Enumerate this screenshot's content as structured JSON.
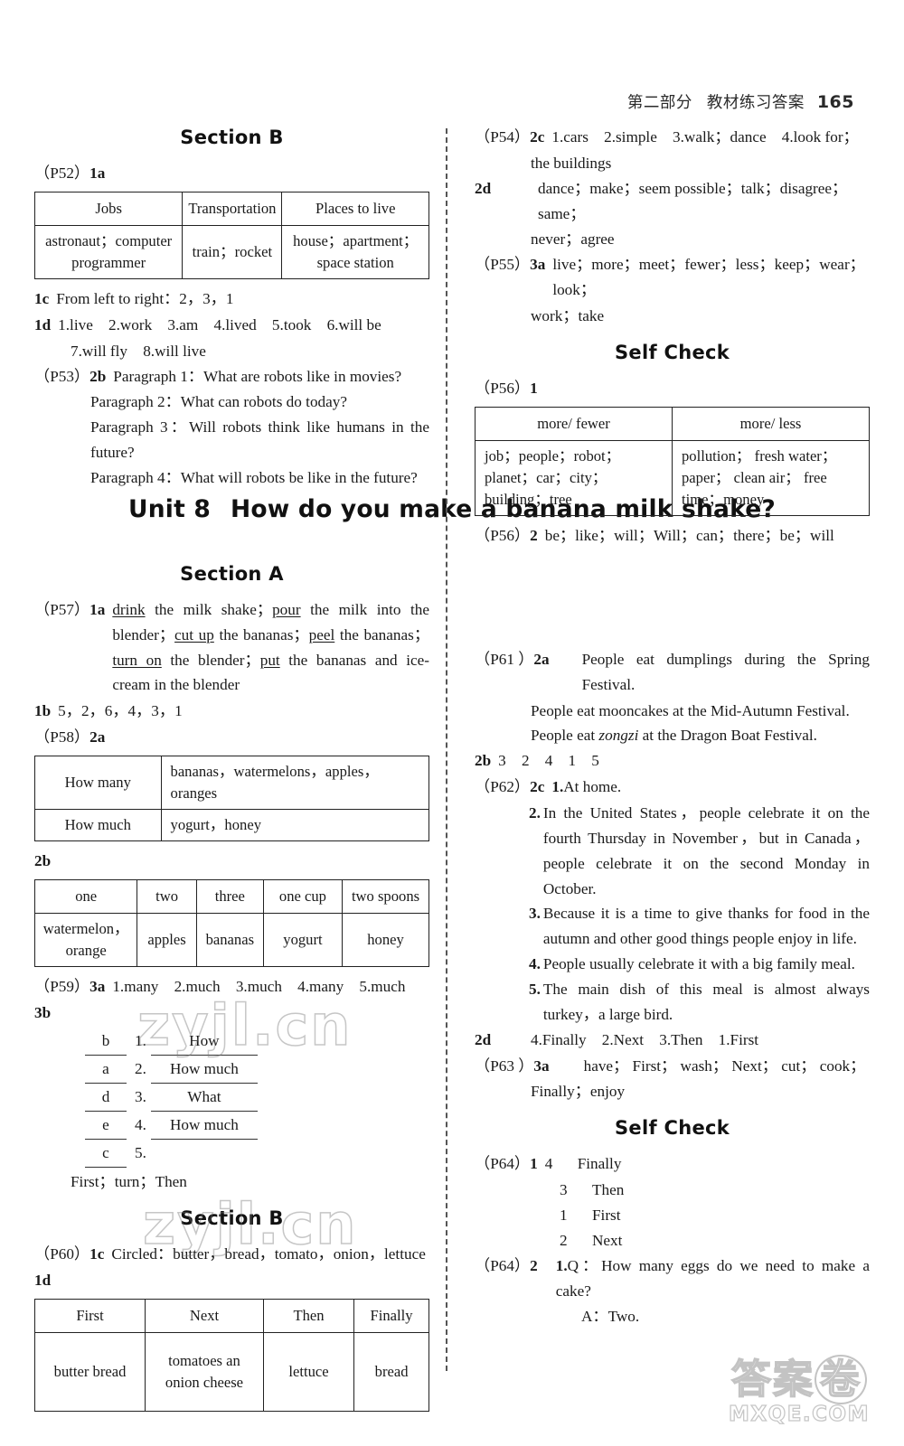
{
  "header": {
    "part_label": "第二部分",
    "section_label": "教材练习答案",
    "page_number": "165"
  },
  "left_column": {
    "section_b_heading": "Section B",
    "p52_tag_paren": "（P52）",
    "p52_tag_item": "1a",
    "table_1a": {
      "headers": [
        "Jobs",
        "Transportation",
        "Places to live"
      ],
      "row": [
        "astronaut；computer programmer",
        "train；rocket",
        "house；apartment；space station"
      ]
    },
    "entry_1c": {
      "tag": "1c",
      "text": "From left to right：2，3，1"
    },
    "entry_1d": {
      "tag": "1d",
      "line1": "1.live　2.work　3.am　4.lived　5.took　6.will be",
      "line2": "7.will fly　8.will live"
    },
    "entry_2b": {
      "tag_paren": "（P53）",
      "tag_item": "2b",
      "lines": [
        "Paragraph 1：What are robots like in movies?",
        "Paragraph 2：What can robots do today?",
        "Paragraph 3：Will robots think like humans in the future?",
        "Paragraph 4：What will robots be like in the future?"
      ]
    },
    "section_a_heading": "Section A",
    "entry_1a": {
      "tag_paren": "（P57）",
      "tag_item": "1a",
      "text_html": "<span class=\"u\">drink</span> the milk shake；<span class=\"u\">pour</span> the milk into the blender；<span class=\"u\">cut up</span> the bananas；<span class=\"u\">peel</span> the bananas；<span class=\"u\">turn on</span> the blender；<span class=\"u\">put</span> the bananas and ice-cream in the blender"
    },
    "entry_1b": {
      "tag": "1b",
      "text": "5，2，6，4，3，1"
    },
    "p58_tag_paren": "（P58）",
    "p58_tag_item": "2a",
    "table_2a": {
      "rows": [
        {
          "label": "How many",
          "value": "bananas，watermelons，apples，oranges"
        },
        {
          "label": "How much",
          "value": "yogurt，honey"
        }
      ]
    },
    "entry_2b_label": "2b",
    "table_2b": {
      "headers": [
        "one",
        "two",
        "three",
        "one cup",
        "two spoons"
      ],
      "row": [
        "watermelon，orange",
        "apples",
        "bananas",
        "yogurt",
        "honey"
      ]
    },
    "entry_3a": {
      "tag_paren": "（P59）",
      "tag_item": "3a",
      "text": "1.many　2.much　3.much　4.many　5.much"
    },
    "entry_3b": {
      "tag": "3b",
      "rows": [
        {
          "letter": "b",
          "n": "1.",
          "answer": "How"
        },
        {
          "letter": "a",
          "n": "2.",
          "answer": "How much"
        },
        {
          "letter": "d",
          "n": "3.",
          "answer": "What"
        },
        {
          "letter": "e",
          "n": "4.",
          "answer": "How much"
        },
        {
          "letter": "c",
          "n": "5.",
          "answer": ""
        }
      ],
      "footer": "First；turn；Then"
    },
    "section_b_heading_2": "Section B",
    "entry_1c_b": {
      "tag_paren": "（P60）",
      "tag_item": "1c",
      "text": "Circled：butter，bread，tomato，onion，lettuce"
    },
    "entry_1d_label": "1d",
    "table_1d": {
      "headers": [
        "First",
        "Next",
        "Then",
        "Finally"
      ],
      "row": [
        "butter bread",
        "tomatoes an onion cheese",
        "lettuce",
        "bread"
      ]
    }
  },
  "right_column": {
    "entry_2c": {
      "tag_paren": "（P54）",
      "tag_item": "2c",
      "line1": "1.cars　2.simple　3.walk；dance　4.look for；",
      "line2": "the buildings"
    },
    "entry_2d": {
      "tag": "2d",
      "line1": "dance；make；seem possible；talk；disagree；same；",
      "line2": "never；agree"
    },
    "entry_3a_p55": {
      "tag_paren": "（P55）",
      "tag_item": "3a",
      "line1": "live；more；meet；fewer；less；keep；wear；look；",
      "line2": "work；take"
    },
    "self_check_heading": "Self Check",
    "p56_tag_paren": "（P56）",
    "p56_tag_item": "1",
    "table_sc1": {
      "headers": [
        "more/ fewer",
        "more/ less"
      ],
      "row": [
        "job；people；robot；planet；car；city；building；tree",
        "pollution； fresh water； paper； clean air； free time；money"
      ]
    },
    "entry_p56_2": {
      "tag_paren": "（P56）",
      "tag_item": "2",
      "text": "be；like；will；Will；can；there；be；will"
    },
    "entry_2a_p61": {
      "tag_paren": "（P61 ）",
      "tag_item": "2a",
      "line1": "People eat dumplings during the Spring Festival.",
      "line2": "People eat mooncakes at the Mid-Autumn Festival.",
      "line3_pre": "People eat ",
      "line3_ital": "zongzi",
      "line3_post": " at the Dragon Boat Festival."
    },
    "entry_2b_p61": {
      "tag": "2b",
      "text": "3　2　4　1　5"
    },
    "entry_2c_p62": {
      "tag_paren": "（P62）",
      "tag_item": "2c",
      "first_n": "1.",
      "first_text": "At home.",
      "items": [
        {
          "n": "2.",
          "text": "In the United States，people celebrate it on the fourth Thursday in November，but in Canada，people celebrate it on the second Monday in October."
        },
        {
          "n": "3.",
          "text": "Because it is a time to give thanks for food in the autumn and other good things people enjoy in life."
        },
        {
          "n": "4.",
          "text": "People usually celebrate it with a big family meal."
        },
        {
          "n": "5.",
          "text": "The main dish of this meal is almost always turkey，a large bird."
        }
      ]
    },
    "entry_2d_p62": {
      "tag": "2d",
      "text": "4.Finally　2.Next　3.Then　1.First"
    },
    "entry_3a_p63": {
      "tag_paren": "（P63 ）",
      "tag_item": "3a",
      "line1": "have； First； wash； Next； cut； cook；",
      "line2": "Finally；enjoy"
    },
    "self_check_heading_2": "Self Check",
    "entry_p64_1": {
      "tag_paren": "（P64）",
      "tag_item": "1",
      "rows": [
        {
          "n": "4",
          "word": "Finally"
        },
        {
          "n": "3",
          "word": "Then"
        },
        {
          "n": "1",
          "word": "First"
        },
        {
          "n": "2",
          "word": "Next"
        }
      ]
    },
    "entry_p64_2": {
      "tag_paren": "（P64）",
      "tag_item": "2",
      "q_n": "1.",
      "q_text": "Q：How many eggs do we need to make a cake?",
      "a_text": "A：Two."
    }
  },
  "unit_banner": {
    "unit_label": "Unit 8",
    "unit_title": "How do you make a banana milk shake?"
  },
  "watermarks": {
    "text_1": "zyjl.cn",
    "text_2": "zyjl.cn",
    "footer_cn": "答案",
    "footer_circle": "卷",
    "footer_domain": "MXQE.COM"
  }
}
